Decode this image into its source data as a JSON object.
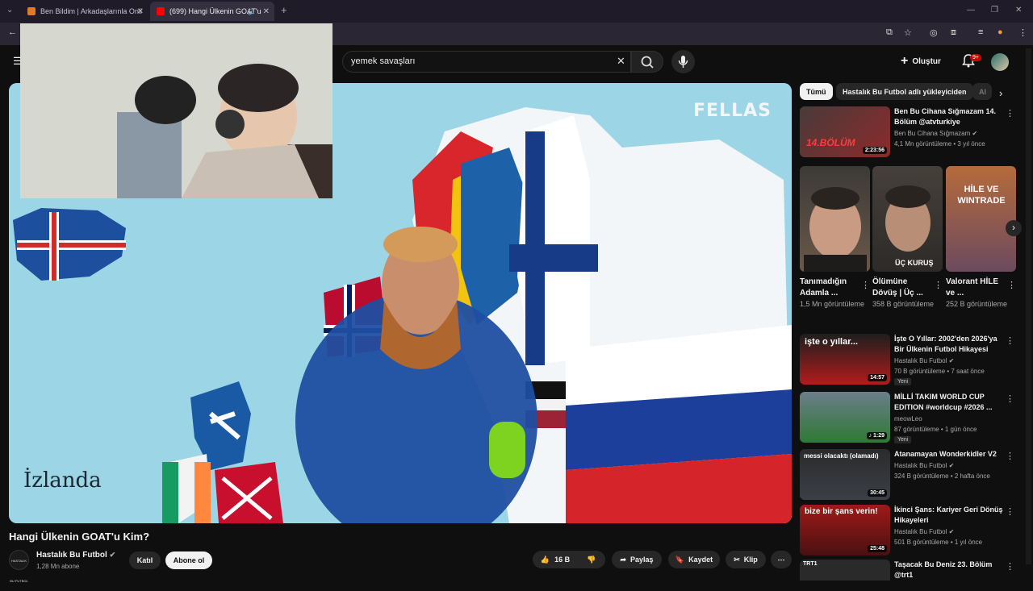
{
  "browser": {
    "tabs": [
      {
        "title": "Ben Bildim | Arkadaşlarınla Onli"
      },
      {
        "title": "(699) Hangi Ülkenin GOAT'u"
      }
    ]
  },
  "header": {
    "search_value": "yemek savaşları",
    "create_label": "Oluştur",
    "notifications_badge": "9+"
  },
  "player": {
    "brand_watermark": "FELLAS",
    "caption": "İzlanda"
  },
  "video": {
    "title": "Hangi Ülkenin GOAT'u Kim?",
    "channel_name": "Hastalık Bu Futbol",
    "channel_avatar_text": "HASTALIK BU FUTBOL",
    "subscribers": "1,28 Mn abone",
    "join_label": "Katıl",
    "subscribe_label": "Abone ol",
    "likes": "16 B",
    "share_label": "Paylaş",
    "save_label": "Kaydet",
    "clip_label": "Klip"
  },
  "sidebar": {
    "chips": [
      "Tümü",
      "Hastalık Bu Futbol adlı yükleyiciden",
      "Al"
    ],
    "top_rec": {
      "title": "Ben Bu Cihana Sığmazam 14. Bölüm @atvturkiye",
      "channel": "Ben Bu Cihana Sığmazam",
      "meta": "4,1 Mn görüntüleme • 3 yıl önce",
      "duration": "2:23:56",
      "thumb_text": "14.BÖLÜM"
    },
    "shorts": [
      {
        "title": "Tanımadığın Adamla ...",
        "views": "1,5 Mn görüntüleme",
        "thumb_text": ""
      },
      {
        "title": "Ölümüne Dövüş | Üç ...",
        "views": "358 B görüntüleme",
        "thumb_text": "ÜÇ KURUŞ"
      },
      {
        "title": "Valorant HİLE ve ...",
        "views": "252 B görüntüleme",
        "thumb_text": "HİLE VE WINTRADE"
      }
    ],
    "recs": [
      {
        "title": "İşte O Yıllar: 2002'den 2026'ya Bir Ülkenin Futbol Hikayesi",
        "channel": "Hastalık Bu Futbol",
        "meta": "70 B görüntüleme • 7 saat önce",
        "duration": "14:57",
        "badge": "Yeni",
        "thumb_text": "işte o yıllar..."
      },
      {
        "title": "MİLLİ TAKIM WORLD CUP EDITION #worldcup #2026 ...",
        "channel": "meowLeo",
        "meta": "87 görüntüleme • 1 gün önce",
        "duration": "1:29",
        "badge": "Yeni",
        "thumb_text": ""
      },
      {
        "title": "Atanamayan Wonderkidler V2",
        "channel": "Hastalık Bu Futbol",
        "meta": "324 B görüntüleme • 2 hafta önce",
        "duration": "30:45",
        "badge": "",
        "thumb_text": "messi olacaktı (olamadı)"
      },
      {
        "title": "İkinci Şans: Kariyer Geri Dönüş Hikayeleri",
        "channel": "Hastalık Bu Futbol",
        "meta": "501 B görüntüleme • 1 yıl önce",
        "duration": "25:48",
        "badge": "",
        "thumb_text": "bize bir şans verin!"
      },
      {
        "title": "Taşacak Bu Deniz 23. Bölüm @trt1",
        "channel": "",
        "meta": "",
        "duration": "",
        "badge": "",
        "thumb_text": "TRT1"
      }
    ]
  },
  "colors": {
    "accent_red": "#cc0000",
    "background": "#0f0f0f",
    "chip_bg": "#272727"
  }
}
